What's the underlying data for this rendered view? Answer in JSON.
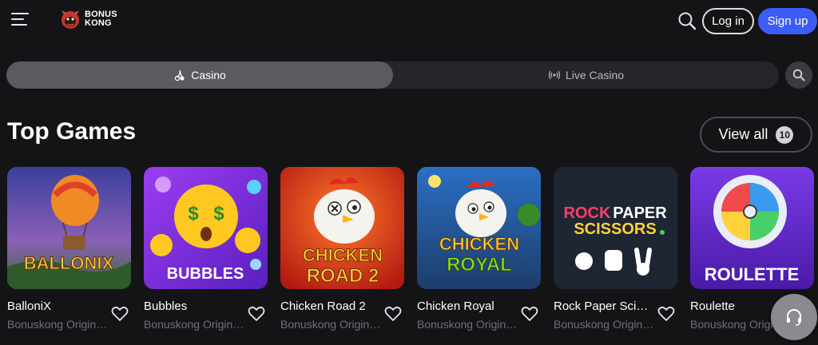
{
  "header": {
    "logo_text_line1": "BONUS",
    "logo_text_line2": "KONG",
    "login_label": "Log in",
    "signup_label": "Sign up",
    "accent_color": "#3d5cf5"
  },
  "tabs": [
    {
      "label": "Casino",
      "icon": "cherries-icon",
      "active": true
    },
    {
      "label": "Live Casino",
      "icon": "broadcast-icon",
      "active": false
    }
  ],
  "section": {
    "title": "Top Games",
    "view_all_label": "View all",
    "view_all_count": "10"
  },
  "games": [
    {
      "name": "BalloniX",
      "provider": "Bonuskong Originals",
      "thumb_text": "BALLONIX"
    },
    {
      "name": "Bubbles",
      "provider": "Bonuskong Originals",
      "thumb_text": "BUBBLES"
    },
    {
      "name": "Chicken Road 2",
      "provider": "Bonuskong Originals",
      "thumb_text_1": "CHICKEN",
      "thumb_text_2": "ROAD 2"
    },
    {
      "name": "Chicken Royal",
      "provider": "Bonuskong Originals",
      "thumb_text_1": "CHICKEN",
      "thumb_text_2": "ROYAL"
    },
    {
      "name": "Rock Paper Scissors",
      "provider": "Bonuskong Originals",
      "thumb_text_1": "ROCK",
      "thumb_text_2": "PAPER",
      "thumb_text_3": "SCISSORS"
    },
    {
      "name": "Roulette",
      "provider": "Bonuskong Originals",
      "thumb_text": "ROULETTE"
    }
  ]
}
